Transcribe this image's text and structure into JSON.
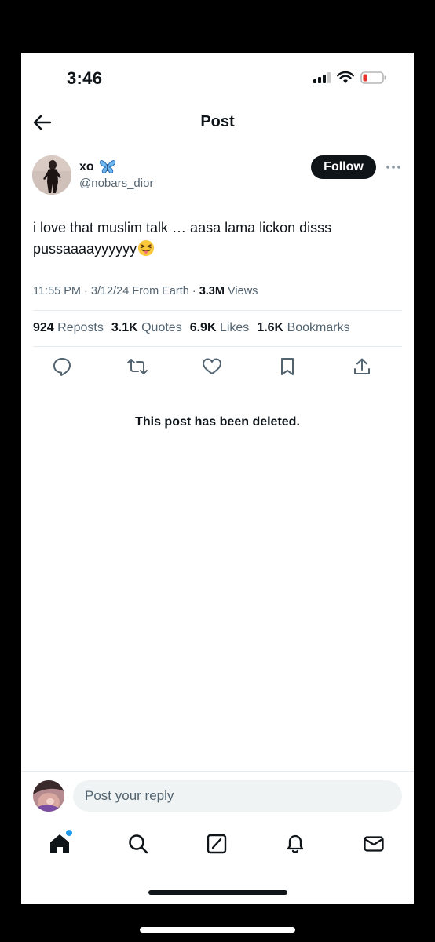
{
  "status_bar": {
    "time": "3:46"
  },
  "header": {
    "title": "Post"
  },
  "author": {
    "name": "xo",
    "handle": "@nobars_dior",
    "follow_label": "Follow"
  },
  "tweet": {
    "text": "i love that muslim talk … aasa lama lickon disss pussaaaayyyyyy",
    "emoji": "squinting-face-with-tongue",
    "time": "11:55 PM",
    "date": "3/12/24",
    "source": "From Earth",
    "views_count": "3.3M",
    "views_label": "Views"
  },
  "stats": {
    "reposts_count": "924",
    "reposts_label": "Reposts",
    "quotes_count": "3.1K",
    "quotes_label": "Quotes",
    "likes_count": "6.9K",
    "likes_label": "Likes",
    "bookmarks_count": "1.6K",
    "bookmarks_label": "Bookmarks"
  },
  "actions": [
    "reply-icon",
    "repost-icon",
    "like-icon",
    "bookmark-icon",
    "share-icon"
  ],
  "deleted_notice": "This post has been deleted.",
  "reply": {
    "placeholder": "Post your reply"
  },
  "nav": [
    "home-icon",
    "search-icon",
    "compose-icon",
    "notifications-icon",
    "messages-icon"
  ],
  "colors": {
    "accent": "#1d9bf0",
    "text": "#0f1419",
    "muted": "#536471",
    "follow_bg": "#0f1419"
  }
}
